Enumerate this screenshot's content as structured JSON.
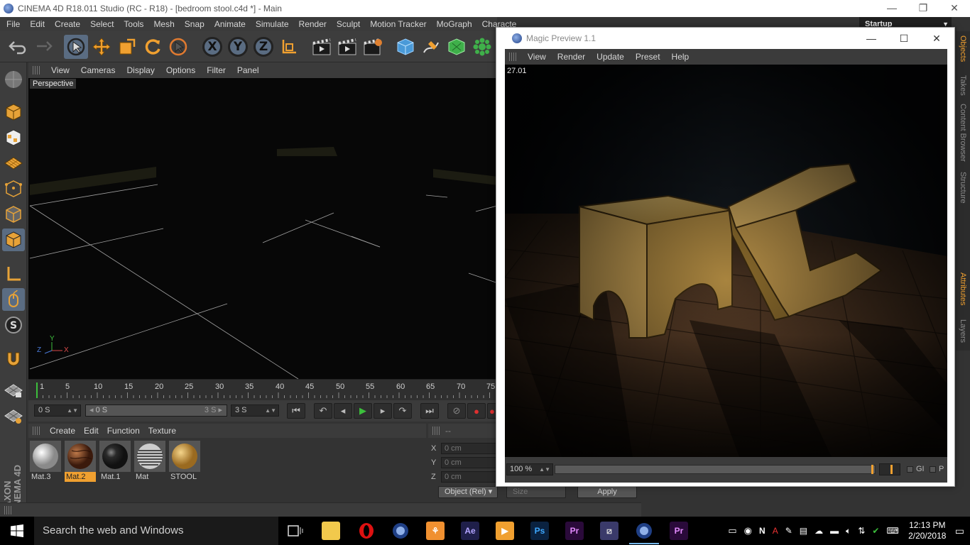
{
  "window": {
    "title": "CINEMA 4D R18.011 Studio (RC - R18) - [bedroom stool.c4d *] - Main",
    "minimize": "—",
    "maximize": "❐",
    "close": "✕"
  },
  "menu": [
    "File",
    "Edit",
    "Create",
    "Select",
    "Tools",
    "Mesh",
    "Snap",
    "Animate",
    "Simulate",
    "Render",
    "Sculpt",
    "Motion Tracker",
    "MoGraph",
    "Characte"
  ],
  "layout": {
    "label": "Startup"
  },
  "toolbar": {
    "x_label": "X",
    "y_label": "Y",
    "z_label": "Z"
  },
  "viewport": {
    "menu": [
      "View",
      "Cameras",
      "Display",
      "Options",
      "Filter",
      "Panel"
    ],
    "label": "Perspective",
    "axis": {
      "y": "Y",
      "z": "Z",
      "x": "X"
    }
  },
  "timeline": {
    "ticks": [
      "5",
      "10",
      "15",
      "20",
      "25",
      "30",
      "35",
      "40",
      "45",
      "50",
      "55",
      "60",
      "65",
      "70",
      "75"
    ],
    "start_marker": "1",
    "current": "0 S",
    "range_start": "0 S",
    "range_end": "3 S",
    "end": "3 S"
  },
  "materials": {
    "menu": [
      "Create",
      "Edit",
      "Function",
      "Texture"
    ],
    "items": [
      {
        "label": "Mat.3",
        "type": "white"
      },
      {
        "label": "Mat.2",
        "type": "wood",
        "selected": true
      },
      {
        "label": "Mat.1",
        "type": "black"
      },
      {
        "label": "Mat",
        "type": "stripe"
      },
      {
        "label": "STOOL",
        "type": "plywood"
      }
    ]
  },
  "coords": {
    "header": "--",
    "rows": [
      {
        "axis": "X",
        "value": "0 cm"
      },
      {
        "axis": "Y",
        "value": "0 cm"
      },
      {
        "axis": "Z",
        "value": "0 cm"
      }
    ],
    "mode": "Object (Rel)",
    "size": "Size",
    "apply": "Apply"
  },
  "side_tabs": [
    "Objects",
    "Takes",
    "Content Browser",
    "Structure",
    "Attributes",
    "Layers"
  ],
  "magic_preview": {
    "title": "Magic Preview 1.1",
    "menu": [
      "View",
      "Render",
      "Update",
      "Preset",
      "Help"
    ],
    "fps": "27.01",
    "zoom": "100 %",
    "gi_label": "GI",
    "p_label": "P"
  },
  "taskbar": {
    "search_placeholder": "Search the web and Windows",
    "time": "12:13 PM",
    "date": "2/20/2018",
    "apps": [
      "task-view",
      "file-explorer",
      "opera",
      "cinema4d",
      "weather",
      "after-effects",
      "media-player",
      "photoshop",
      "premiere",
      "slicer",
      "cinema4d-active",
      "premiere-2"
    ]
  },
  "colors": {
    "accent": "#f0a030",
    "selected_tool": "#5a6c82",
    "panel": "#333333",
    "taskbar": "#000000"
  }
}
